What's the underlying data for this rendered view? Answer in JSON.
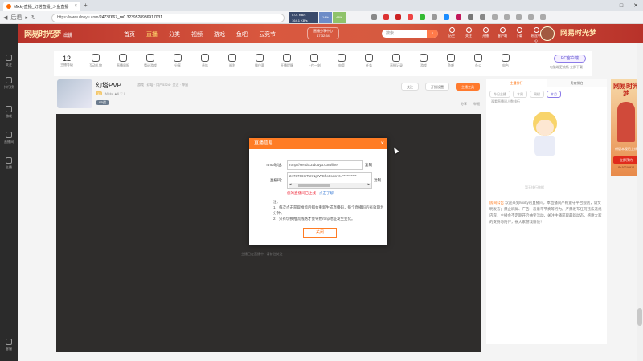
{
  "browser": {
    "tab_title": "Mixky直播_幻塔直播_斗鱼直播",
    "tab_close": "×",
    "new_tab": "+",
    "nav_back_label": "后退",
    "url_prefix": "https://www.douyu.com/",
    "url_rest": "24737667_r=0.3239528936917031",
    "net_up": "0.01 KB/s",
    "net_down": "164.1 KB/s",
    "cpu": "14%",
    "mem": "48%",
    "win_min": "—",
    "win_max": "□",
    "win_close": "✕"
  },
  "header": {
    "logo": "网易时光梦",
    "logo_sub": "出镜",
    "nav": [
      "首页",
      "直播",
      "分类",
      "视频",
      "游戏",
      "鱼吧",
      "云竞节"
    ],
    "active_nav": "直播",
    "live_pill_line1": "直播分享中心",
    "live_pill_line2": "17:32:54",
    "search_placeholder": "搜索",
    "icons": [
      "历史",
      "关注",
      "开播",
      "客户端",
      "下载",
      "粉丝中心"
    ],
    "banner_right": "网易时光梦"
  },
  "sidebar": {
    "items": [
      "关注",
      "排行榜",
      "游戏",
      "直播间",
      "主播"
    ],
    "bottom": "客服"
  },
  "giftbar": {
    "level_num": "12",
    "level_label": "主播等级",
    "items": [
      "互动礼物",
      "直播周报",
      "猜谜游戏",
      "分享",
      "贵族",
      "福利",
      "排位赛",
      "开播提醒",
      "上传一刻",
      "电竞",
      "任务",
      "直播记录",
      "游戏",
      "鱼吧",
      "办公",
      "电台",
      "分享"
    ],
    "pc_button": "PC客户端",
    "pc_note": "电脑端更流畅 立即下载"
  },
  "room": {
    "name": "幻塔PVP",
    "meta": "游戏 · 幻塔 · 用户5324 · 关注 · 举报",
    "sub_level": "13",
    "sub_text": "Mixky  ▲6  ♡ 0",
    "badge": "V5战",
    "buttons": [
      "关注",
      "开播设置"
    ],
    "orange_button": "主播工具",
    "actions": [
      "分享",
      "举报"
    ]
  },
  "player": {
    "footer_text": "主播已在直播中 · 请前往关注"
  },
  "right": {
    "tabs": [
      "主播排行",
      "贵宾排名"
    ],
    "filters": [
      "今日主播",
      "本周",
      "周榜",
      "本月"
    ],
    "active_filter": "本月",
    "sub": "观看直播间人数排行",
    "empty_text": "暂无排行数据",
    "notice_tag": "房间公告",
    "notice_text": "欢迎来到Mixky的直播间，本直播间严格遵守平台规则，请文明发言；禁止刷屏、广告、恶意带节奏等行为。严禁发布任何违法违规内容，主播会不定期开启抽奖活动，关注主播获取最新动态，感谢大家的支持与陪伴，祝大家游戏愉快！"
  },
  "ad": {
    "title": "网易时光梦",
    "caption": "新版本现已上线",
    "button": "立即预约",
    "code": "ID:10016914"
  },
  "modal": {
    "title": "直播信息",
    "close": "×",
    "rtmp_label": "rtmp地址：",
    "rtmp_value": "rtmp://sendtc3.douyu.com/live",
    "rtmp_copy": "复制",
    "key_label": "直播码：",
    "key_value": "24737667rTsXNgrWCho0secret=**********",
    "key_copy": "复制",
    "warn": "您的直播间已上线",
    "warn_link": "点击了解",
    "tips_title": "注：",
    "tip1": "1、每次点击获取推流后都会重新生成直播码，每个直播码的有效期为分钟。",
    "tip2": "2、只有切换推流线路才会导致rtmp地址发生变化。",
    "ok": "关闭"
  },
  "colors": {
    "header": "#c94a3c",
    "accent": "#ff7c24",
    "player_bg": "#2f2d2c"
  }
}
